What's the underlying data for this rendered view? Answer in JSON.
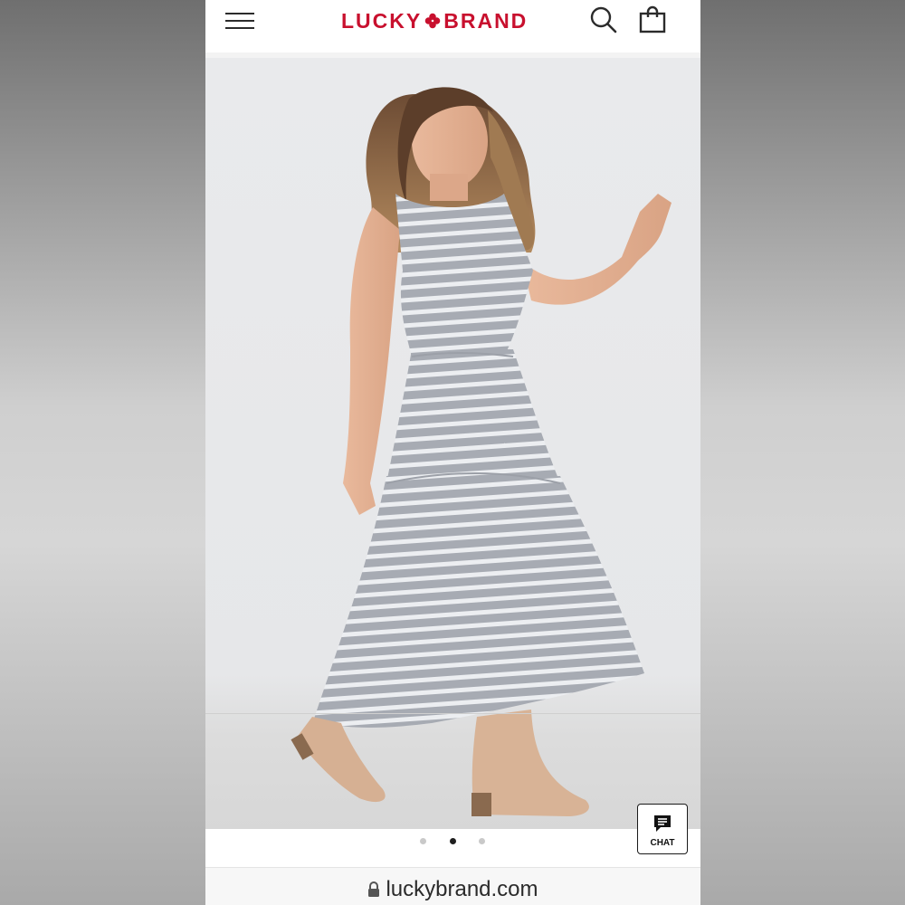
{
  "header": {
    "brand_left": "LUCKY",
    "brand_right": "BRAND",
    "brand_color": "#c8102e",
    "menu_icon": "hamburger-menu-icon",
    "search_icon": "search-icon",
    "bag_icon": "shopping-bag-icon"
  },
  "product_image": {
    "description_icon": "product-photo",
    "carousel": {
      "count": 3,
      "active_index": 1
    }
  },
  "chat": {
    "label": "CHAT",
    "icon": "chat-bubble-icon"
  },
  "browser": {
    "url": "luckybrand.com",
    "icon": "lock-icon"
  }
}
